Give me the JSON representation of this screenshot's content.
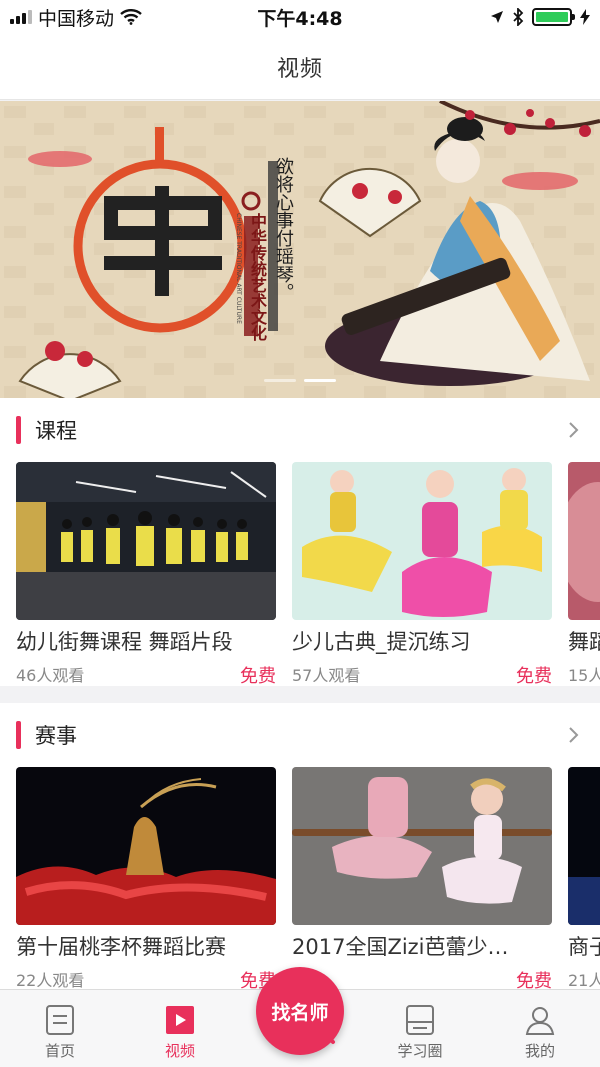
{
  "status_bar": {
    "carrier": "中国移动",
    "time": "下午4:48"
  },
  "nav": {
    "title": "视频"
  },
  "banner": {
    "poem": "欲将心事付瑶琴。",
    "brand": "中华传统艺术文化",
    "brand_en": "CHINESE TRADITIONAL ART CULTURE",
    "slide_count": 2,
    "active_slide": 2
  },
  "sections": [
    {
      "title": "课程",
      "cards": [
        {
          "title": "幼儿街舞课程 舞蹈片段",
          "views": "46人观看",
          "price": "免费"
        },
        {
          "title": "少儿古典_提沉练习",
          "views": "57人观看",
          "price": "免费"
        },
        {
          "title": "舞蹈",
          "views": "15人",
          "price": ""
        }
      ]
    },
    {
      "title": "赛事",
      "cards": [
        {
          "title": "第十届桃李杯舞蹈比赛",
          "views": "22人观看",
          "price": "免费"
        },
        {
          "title": "2017全国Zizi芭蕾少…",
          "views": "观看",
          "price": "免费"
        },
        {
          "title": "商子",
          "views": "21人",
          "price": ""
        }
      ]
    }
  ],
  "tab_bar": {
    "tabs": [
      {
        "label": "首页",
        "icon": "home-doc-icon"
      },
      {
        "label": "视频",
        "icon": "play-icon"
      },
      {
        "label": "学习圈",
        "icon": "book-icon"
      },
      {
        "label": "我的",
        "icon": "user-icon"
      }
    ],
    "center_label": "找名师",
    "active_index": 1
  },
  "colors": {
    "accent": "#e8305b",
    "battery": "#2fcc5a"
  }
}
